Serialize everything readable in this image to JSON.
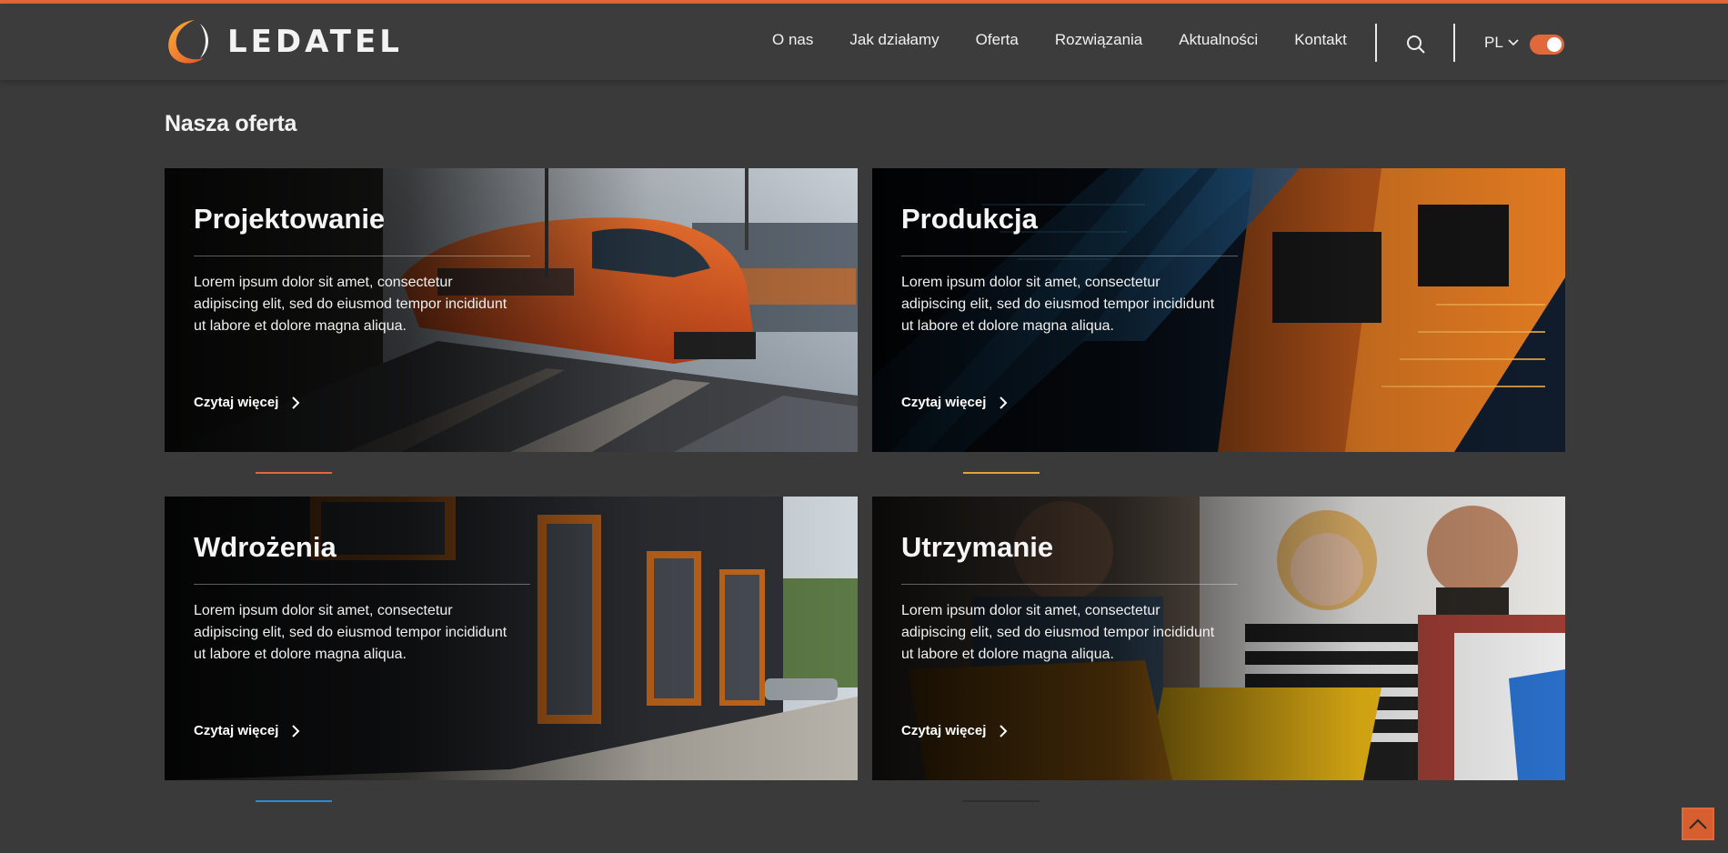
{
  "brand": {
    "name": "LEDATEL",
    "accent_color": "#e0683a"
  },
  "nav": {
    "items": [
      "O nas",
      "Jak działamy",
      "Oferta",
      "Rozwiązania",
      "Aktualności",
      "Kontakt"
    ]
  },
  "header": {
    "language": "PL",
    "search_icon": "search-icon",
    "theme_toggle_on": true
  },
  "section": {
    "title": "Nasza oferta"
  },
  "cards": [
    {
      "title": "Projektowanie",
      "text": "Lorem ipsum dolor sit amet, consectetur adipiscing elit, sed do eiusmod tempor incididunt ut labore et dolore magna aliqua.",
      "link": "Czytaj więcej",
      "accent": "#e0683a"
    },
    {
      "title": "Produkcja",
      "text": "Lorem ipsum dolor sit amet, consectetur adipiscing elit, sed do eiusmod tempor incididunt ut labore et dolore magna aliqua.",
      "link": "Czytaj więcej",
      "accent": "#e6a33a"
    },
    {
      "title": "Wdrożenia",
      "text": "Lorem ipsum dolor sit amet, consectetur adipiscing elit, sed do eiusmod tempor incididunt ut labore et dolore magna aliqua.",
      "link": "Czytaj więcej",
      "accent": "#2a8bd4"
    },
    {
      "title": "Utrzymanie",
      "text": "Lorem ipsum dolor sit amet, consectetur adipiscing elit, sed do eiusmod tempor incididunt ut labore et dolore magna aliqua.",
      "link": "Czytaj więcej",
      "accent": "#2e2e2e"
    }
  ]
}
